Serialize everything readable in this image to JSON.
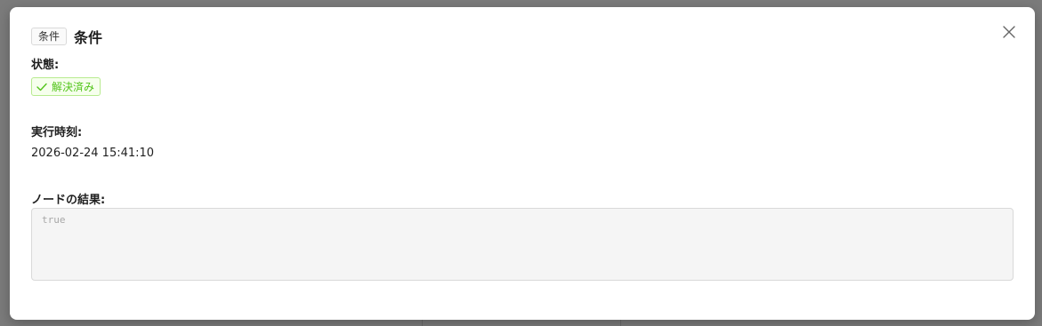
{
  "modal": {
    "type_tag": "条件",
    "title": "条件"
  },
  "status": {
    "label": "状態:",
    "value": "解決済み",
    "color": "#52c41a"
  },
  "execution_time": {
    "label": "実行時刻:",
    "value": "2026-02-24 15:41:10"
  },
  "node_result": {
    "label": "ノードの結果:",
    "value": "true"
  },
  "icons": {
    "close": "close-icon",
    "status": "check-icon"
  }
}
